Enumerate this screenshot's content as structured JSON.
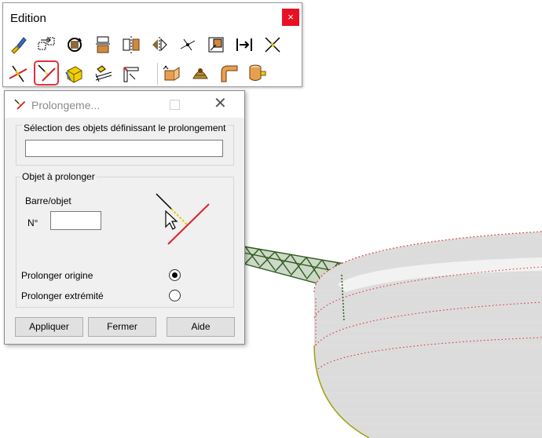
{
  "toolbar": {
    "title": "Edition",
    "close_glyph": "×",
    "row1_icons": [
      "paint-brush-icon",
      "move-objects-icon",
      "rotate-icon",
      "copy-translate-icon",
      "mirror-plane-icon",
      "symmetry-icon",
      "divide-icon",
      "scale-icon",
      "extend-to-icon",
      "cross-cut-icon"
    ],
    "row2_icons": [
      "trim-icon",
      "extend-icon",
      "extrude-icon",
      "section-cut-icon",
      "corner-icon",
      "thicken-icon",
      "extrude-surface-icon",
      "bend-pipe-icon",
      "cylinder-tool-icon"
    ],
    "selected_tool": "extend-icon"
  },
  "dialog": {
    "title": "Prolongeme...",
    "icon": "extend-icon",
    "selection_group_label": "Sélection des objets définissant le prolongement",
    "selection_value": "",
    "object_group_label": "Objet à prolonger",
    "bar_label": "Barre/objet",
    "number_label": "N°",
    "number_value": "",
    "radio_origin_label": "Prolonger origine",
    "radio_end_label": "Prolonger extrémité",
    "radio_selected": "origin",
    "btn_apply": "Appliquer",
    "btn_close": "Fermer",
    "btn_help": "Aide"
  },
  "colors": {
    "close_red": "#e81123",
    "highlight_red": "#e3313c",
    "truss_green": "#2f5a1c",
    "tank_red": "#e0202a"
  }
}
